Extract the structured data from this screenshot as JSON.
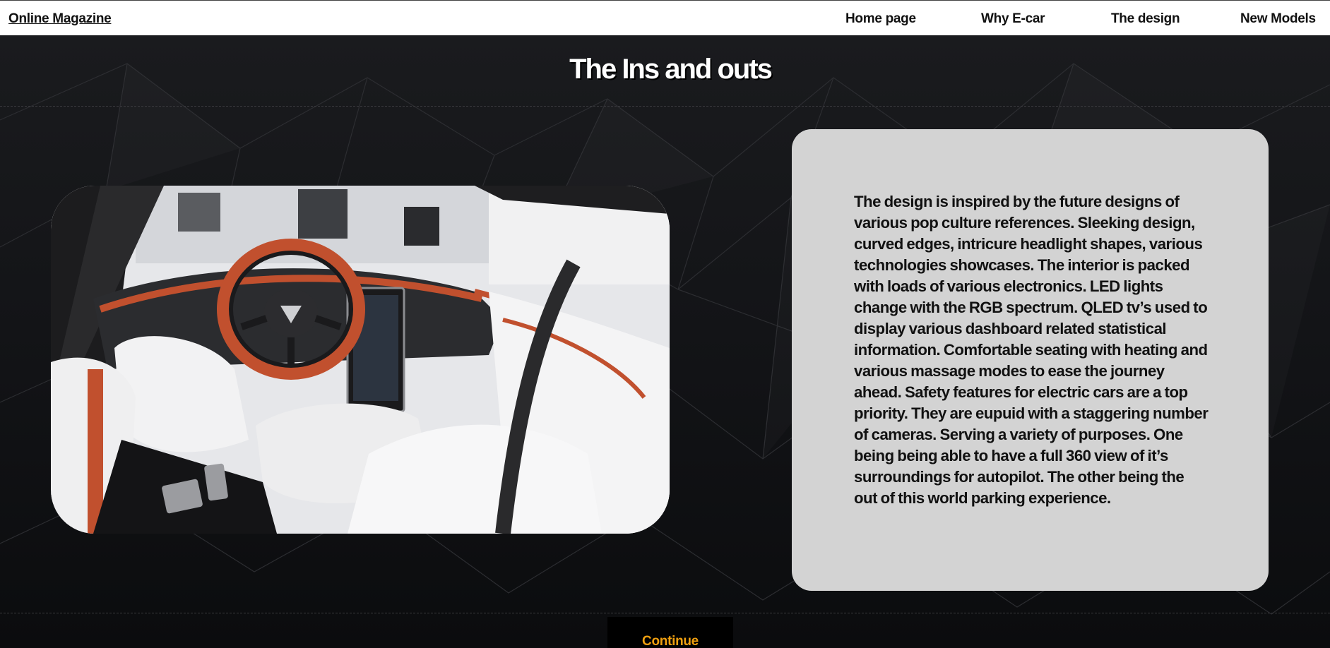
{
  "header": {
    "brand": "Online Magazine",
    "nav": [
      "Home page",
      "Why E-car",
      "The design",
      "New Models"
    ]
  },
  "main": {
    "title": "The Ins and outs",
    "description": "The design is inspired by the future designs of various pop culture references. Sleeking design, curved edges, intricure headlight shapes, various technologies showcases. The interior is packed with loads of various electronics. LED lights change with the RGB spectrum. QLED tv’s used to display various dashboard related statistical information. Comfortable seating with heating and various massage modes to ease the journey ahead. Safety features for electric cars are a top priority. They are eupuid with a staggering number of cameras. Serving a variety of purposes. One being being able to have a full 360 view of it’s surroundings for autopilot. The other being the out of this world parking experience.",
    "image": {
      "subject": "electric car interior with steering wheel, center touchscreen and white seats"
    },
    "continue_label": "Continue"
  },
  "colors": {
    "background": "#0e0f11",
    "navbar": "#ffffff",
    "card": "#d3d3d3",
    "continue_text": "#f0a010",
    "title": "#ffffff"
  }
}
